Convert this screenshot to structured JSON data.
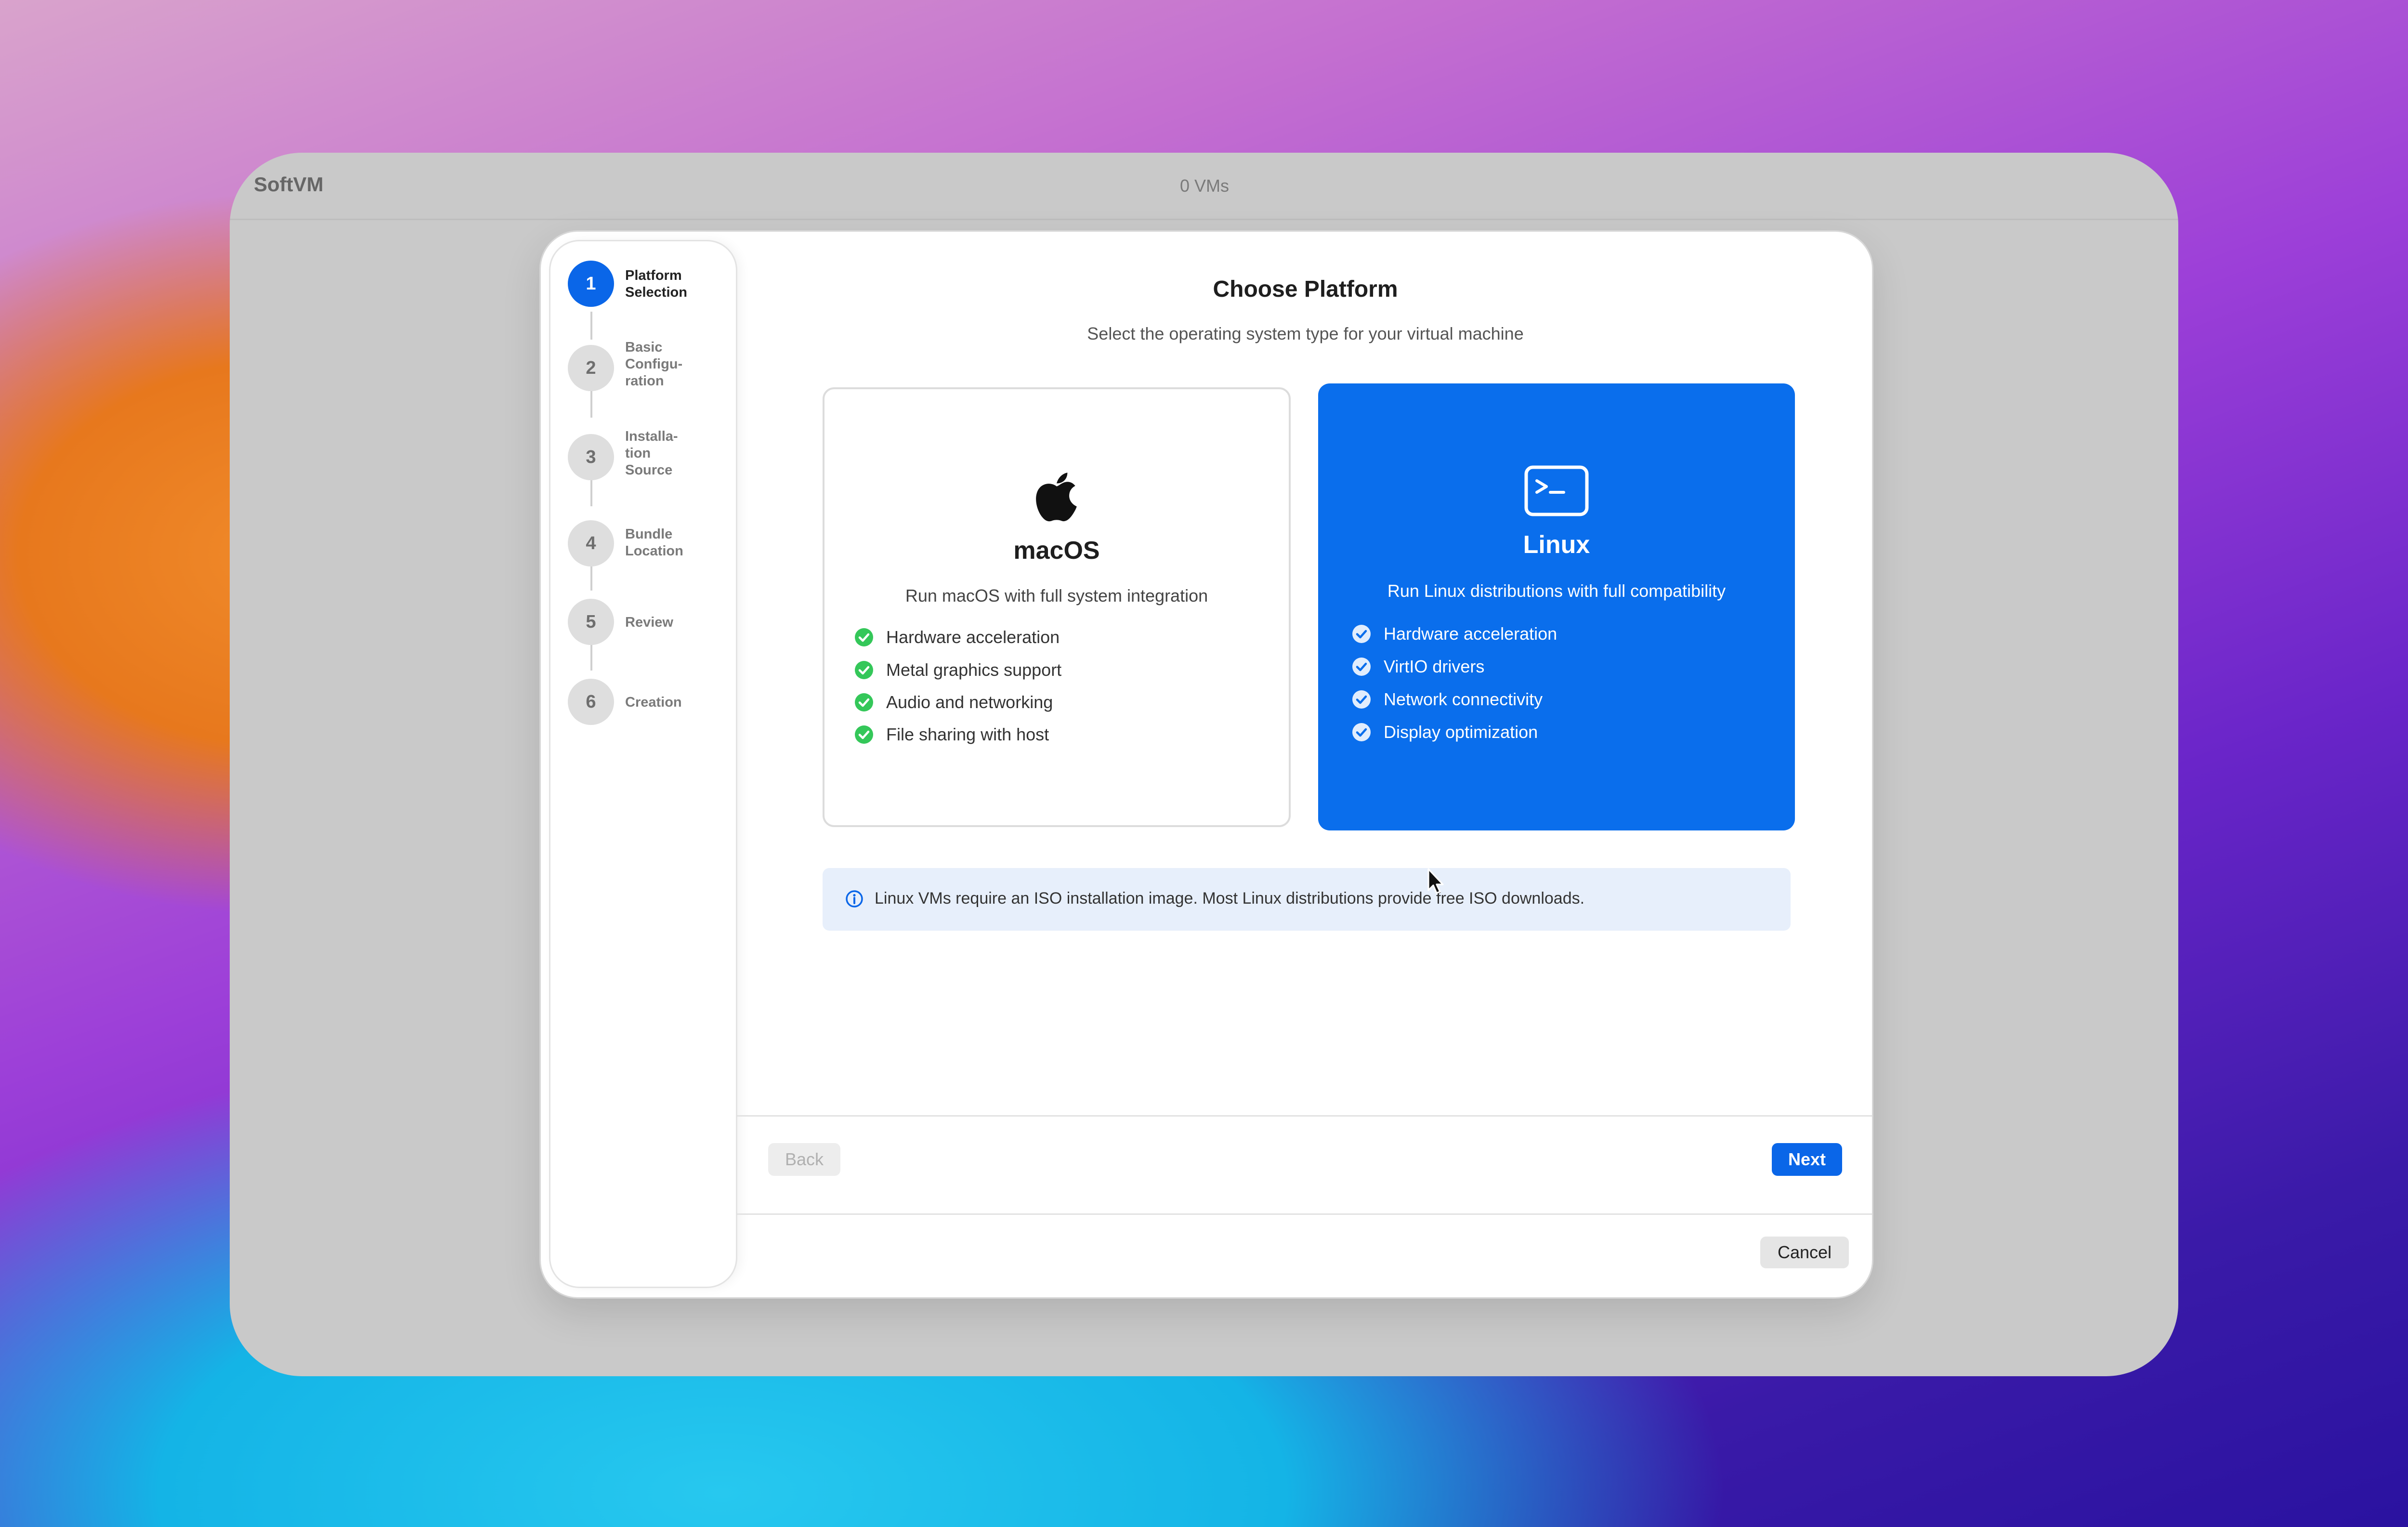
{
  "window": {
    "app_title": "SoftVM",
    "vm_count": "0 VMs"
  },
  "steps": [
    {
      "number": "1",
      "label": "Platform Selection",
      "state": "active"
    },
    {
      "number": "2",
      "label": "Basic Configu-ration",
      "state": "pending"
    },
    {
      "number": "3",
      "label": "Installa-tion Source",
      "state": "pending"
    },
    {
      "number": "4",
      "label": "Bundle Location",
      "state": "pending"
    },
    {
      "number": "5",
      "label": "Review",
      "state": "pending"
    },
    {
      "number": "6",
      "label": "Creation",
      "state": "pending"
    }
  ],
  "header": {
    "title": "Choose Platform",
    "subtitle": "Select the operating system type for your virtual machine"
  },
  "platforms": {
    "macos": {
      "icon": "apple-icon",
      "title": "macOS",
      "description": "Run macOS with full system integration",
      "features": [
        "Hardware acceleration",
        "Metal graphics support",
        "Audio and networking",
        "File sharing with host"
      ],
      "selected": false
    },
    "linux": {
      "icon": "terminal-icon",
      "title": "Linux",
      "description": "Run Linux distributions with full compatibility",
      "features": [
        "Hardware acceleration",
        "VirtIO drivers",
        "Network connectivity",
        "Display optimization"
      ],
      "selected": true
    }
  },
  "info": {
    "icon": "info-icon",
    "text": "Linux VMs require an ISO installation image. Most Linux distributions provide free ISO downloads."
  },
  "buttons": {
    "back": "Back",
    "next": "Next",
    "cancel": "Cancel"
  },
  "colors": {
    "accent": "#0a66e8",
    "linux_card": "#0a6eec",
    "check_green": "#34c759",
    "info_bg": "#e7effb"
  }
}
